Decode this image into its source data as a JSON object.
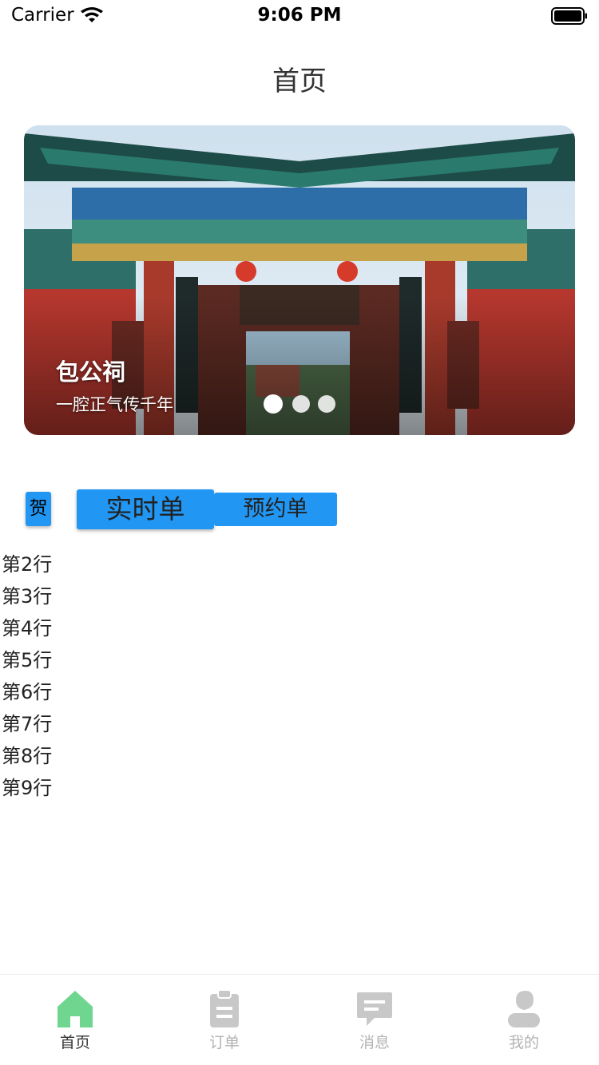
{
  "status_bar": {
    "carrier": "Carrier",
    "time": "9:06 PM"
  },
  "nav": {
    "title": "首页"
  },
  "banner": {
    "title": "包公祠",
    "subtitle": "一腔正气传千年",
    "plaque_text": "祠公包",
    "dots_count": 3,
    "active_dot": 0
  },
  "tabs": {
    "he_label": "贺",
    "realtime_label": "实时单",
    "booking_label": "预约单",
    "accent_color": "#2196f3"
  },
  "list": {
    "items": [
      "第2行",
      "第3行",
      "第4行",
      "第5行",
      "第6行",
      "第7行",
      "第8行",
      "第9行"
    ]
  },
  "tab_bar": {
    "items": [
      {
        "label": "首页",
        "icon": "home-icon",
        "active": true
      },
      {
        "label": "订单",
        "icon": "clipboard-icon",
        "active": false
      },
      {
        "label": "消息",
        "icon": "message-icon",
        "active": false
      },
      {
        "label": "我的",
        "icon": "user-icon",
        "active": false
      }
    ],
    "active_color": "#6fd68f",
    "inactive_color": "#c8c8c8"
  }
}
